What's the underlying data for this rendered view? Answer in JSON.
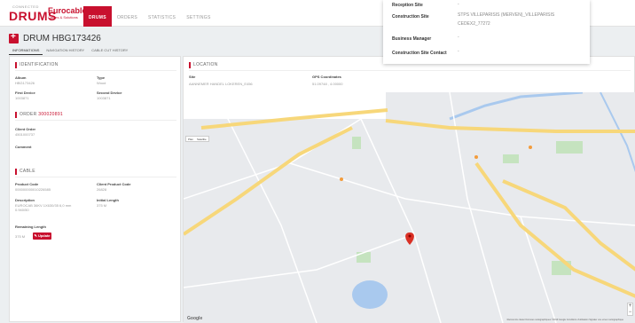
{
  "header": {
    "logo_small": "CONNECTED",
    "logo_big": "DRUMS",
    "brand_name": "Eurocable",
    "brand_sub": "Cables & Solutions",
    "nav": [
      {
        "label": "DRUMS",
        "active": true
      },
      {
        "label": "ORDERS",
        "active": false
      },
      {
        "label": "STATISTICS",
        "active": false
      },
      {
        "label": "SETTINGS",
        "active": false
      }
    ]
  },
  "drum": {
    "title": "DRUM HBG173426",
    "tabs": [
      "INFORMATIONS",
      "NAVIGATION HISTORY",
      "CABLE CUT HISTORY"
    ]
  },
  "identification": {
    "heading": "IDENTIFICATION",
    "album_label": "Album",
    "album_value": "HBG173426",
    "type_label": "Type",
    "type_value": "Wood",
    "first_device_label": "First Device",
    "first_device_value": "1003871",
    "second_device_label": "Second Device",
    "second_device_value": "1003871"
  },
  "order": {
    "heading_prefix": "ORDER",
    "order_number": "300020891",
    "client_order_label": "Client Order",
    "client_order_value": "4501000737",
    "comment_label": "Comment"
  },
  "cable": {
    "heading": "CABLE",
    "product_code_label": "Product Code",
    "product_code_value": "000000000010226585",
    "client_product_code_label": "Client Product Code",
    "client_product_code_value": "26828",
    "description_label": "Description",
    "description_line1": "EUROCAB 36KV 1X630/35 6,0 mm",
    "description_line2": "0.940/50",
    "initial_length_label": "Initial Length",
    "initial_length_value": "375 M",
    "remaining_length_label": "Remaining Length",
    "remaining_length_value": "375 M",
    "update_label": "✎ Update"
  },
  "location": {
    "heading": "LOCATION",
    "site_label": "Site",
    "site_value": "AANNEMER HANDEL LOKEREN_E456",
    "gps_label": "GPS Coordinates",
    "gps_value": "51.09748 , 4.00000",
    "map_tabs": [
      "Plan",
      "Satellite"
    ],
    "google": "Google",
    "credit": "Raccourcis clavier   Données cartographiques ©2019 Google   Conditions d'utilisation   Signaler une erreur cartographique",
    "zoom_in": "+",
    "zoom_out": "−"
  },
  "overlay": {
    "reception_site_label": "Reception Site",
    "reception_site_value": "-",
    "construction_site_label": "Construction Site",
    "construction_site_line1": "STPS VILLEPARISIS (MERVEN)_VILLEPARISIS",
    "construction_site_line2": "CEDEX2_77272",
    "business_manager_label": "Business Manager",
    "business_manager_value": "-",
    "site_contact_label": "Construction Site Contact",
    "site_contact_value": "-"
  },
  "colors": {
    "accent": "#c8102e",
    "map_roads": "#f7e08a",
    "map_water": "#a9c9ee",
    "map_green": "#c5e3bf"
  }
}
